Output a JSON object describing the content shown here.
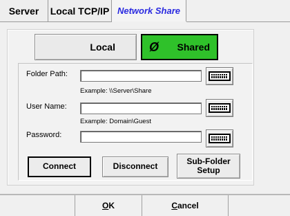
{
  "tabs": [
    {
      "label": "Server"
    },
    {
      "label": "Local TCP/IP"
    },
    {
      "label": "Network Share",
      "active": true
    }
  ],
  "mode": {
    "local_label": "Local",
    "shared_label": "Shared",
    "shared_icon": "Ø",
    "shared_color": "#2fc12a",
    "selected": "Shared"
  },
  "form": {
    "folder_path": {
      "label": "Folder Path:",
      "value": "",
      "example": "Example: \\\\Server\\Share"
    },
    "user_name": {
      "label": "User Name:",
      "value": "",
      "example": "Example: Domain\\Guest"
    },
    "password": {
      "label": "Password:",
      "value": ""
    }
  },
  "actions": {
    "connect": "Connect",
    "disconnect": "Disconnect",
    "subfolder_line1": "Sub-Folder",
    "subfolder_line2": "Setup"
  },
  "footer": {
    "ok_mnemonic": "O",
    "ok_rest": "K",
    "cancel_mnemonic": "C",
    "cancel_rest": "ancel"
  }
}
